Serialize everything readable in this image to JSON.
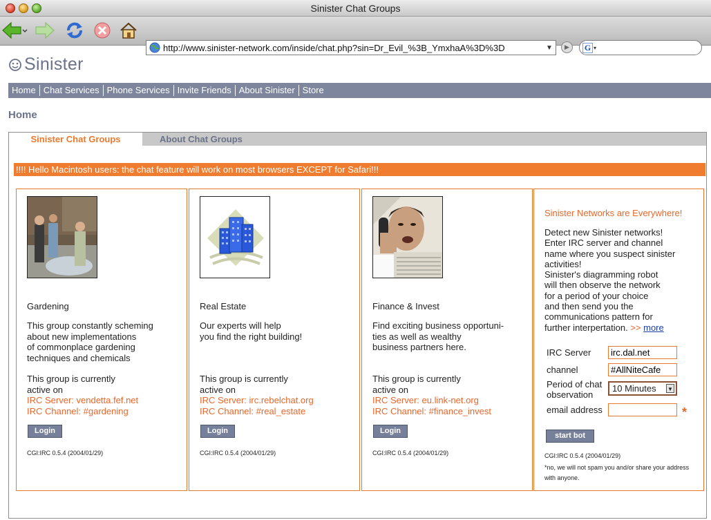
{
  "window": {
    "title": "Sinister Chat Groups"
  },
  "browser": {
    "url": "http://www.sinister-network.com/inside/chat.php?sin=Dr_Evil_%3B_YmxhaA%3D%3D",
    "search_icon_letter": "G"
  },
  "site": {
    "logo_text": "Sinister",
    "nav": [
      "Home",
      "Chat Services",
      "Phone Services",
      "Invite Friends",
      "About Sinister",
      "Store"
    ],
    "page_title": "Home"
  },
  "tabs": {
    "active": "Sinister Chat Groups",
    "other": "About Chat Groups"
  },
  "alert": "!!!! Hello Macintosh users: the chat feature will work on most browsers EXCEPT for Safari!!!",
  "groups": [
    {
      "name": "Gardening",
      "desc": [
        "This group constantly scheming",
        "about new implementations",
        "of commonplace gardening",
        "techniques and chemicals"
      ],
      "active_line1": "This group is currently",
      "active_line2": "active on",
      "irc_server": "IRC Server: vendetta.fef.net",
      "irc_channel": "IRC Channel: #gardening",
      "login": "Login",
      "cgi_link": "CGI:IRC",
      "cgi_version": " 0.5.4 (2004/01/29)"
    },
    {
      "name": "Real Estate",
      "desc": [
        "Our experts will help",
        "you find the right building!"
      ],
      "active_line1": "This group is currently",
      "active_line2": "active on",
      "irc_server": "IRC Server: irc.rebelchat.org",
      "irc_channel": "IRC Channel: #real_estate",
      "login": "Login",
      "cgi_link": "CGI:IRC",
      "cgi_version": " 0.5.4 (2004/01/29)"
    },
    {
      "name": "Finance & Invest",
      "desc": [
        "Find exciting business opportuni-",
        "ties as well as wealthy",
        "business partners here."
      ],
      "active_line1": "This group is currently",
      "active_line2": "active on",
      "irc_server": "IRC Server: eu.link-net.org",
      "irc_channel": "IRC Channel: #finance_invest",
      "login": "Login",
      "cgi_link": "CGI:IRC",
      "cgi_version": " 0.5.4 (2004/01/29)"
    }
  ],
  "sidebar": {
    "title": "Sinister Networks are Everywhere!",
    "text": [
      "Detect new Sinister networks!",
      "Enter IRC server and channel",
      "name where you suspect sinister",
      "activities!",
      "Sinister's diagramming robot",
      "will then observe the network",
      "for a period of your choice",
      "and then send you the",
      "communications pattern for",
      "further interpertation."
    ],
    "more_arrow": ">>",
    "more_link": "more",
    "form": {
      "irc_server_label": "IRC Server",
      "irc_server_value": "irc.dal.net",
      "channel_label": "channel",
      "channel_value": "#AllNiteCafe",
      "period_label_1": "Period of chat",
      "period_label_2": "observation",
      "period_value": "10 Minutes",
      "email_label": "email address",
      "email_value": "",
      "required_mark": "*",
      "submit": "start bot"
    },
    "cgi_link": "CGI:IRC",
    "cgi_version": " 0.5.4 (2004/01/29)",
    "note": "*no, we will not spam you and/or share your address with anyone."
  }
}
